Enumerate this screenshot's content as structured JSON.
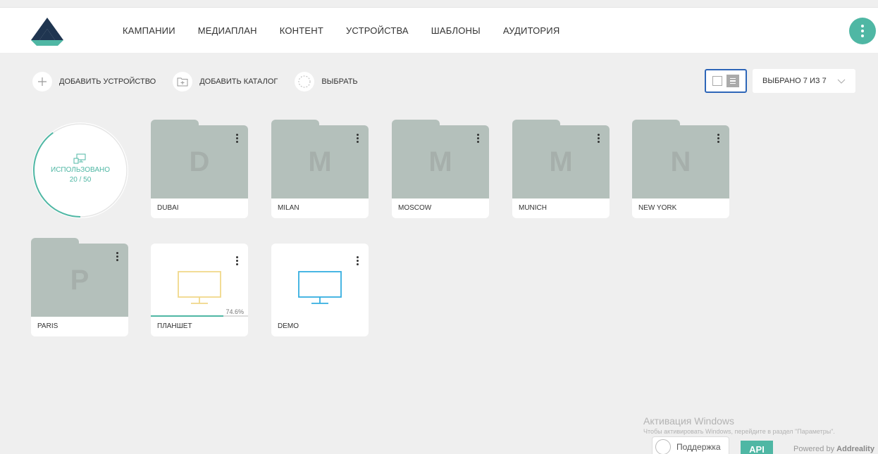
{
  "nav": {
    "items": [
      "КАМПАНИИ",
      "МЕДИАПЛАН",
      "КОНТЕНТ",
      "УСТРОЙСТВА",
      "ШАБЛОНЫ",
      "АУДИТОРИЯ"
    ]
  },
  "toolbar": {
    "add_device": "ДОБАВИТЬ УСТРОЙСТВО",
    "add_catalog": "ДОБАВИТЬ КАТАЛОГ",
    "select": "ВЫБРАТЬ"
  },
  "selection": {
    "label": "ВЫБРАНО 7 ИЗ 7"
  },
  "usage": {
    "label": "ИСПОЛЬЗОВАНО",
    "count": "20 / 50",
    "used": 20,
    "total": 50
  },
  "folders": [
    {
      "letter": "D",
      "name": "DUBAI"
    },
    {
      "letter": "M",
      "name": "MILAN"
    },
    {
      "letter": "M",
      "name": "MOSCOW"
    },
    {
      "letter": "M",
      "name": "MUNICH"
    },
    {
      "letter": "N",
      "name": "NEW YORK"
    },
    {
      "letter": "P",
      "name": "PARIS"
    }
  ],
  "devices": [
    {
      "name": "ПЛАНШЕТ",
      "percent_label": "74.6%",
      "progress": 0.746,
      "color": "#f0d88a"
    },
    {
      "name": "DEMO",
      "percent_label": "",
      "progress": 0,
      "color": "#35aee0"
    }
  ],
  "colors": {
    "accent": "#4fb7a4",
    "folder": "#b4c0bb",
    "toggle_highlight": "#2e66b8"
  },
  "watermark": {
    "title": "Активация Windows",
    "subtitle": "Чтобы активировать Windows, перейдите в раздел \"Параметры\"."
  },
  "footer": {
    "support": "Поддержка",
    "api": "API",
    "powered_prefix": "Powered by",
    "powered_brand": "Addreality"
  }
}
